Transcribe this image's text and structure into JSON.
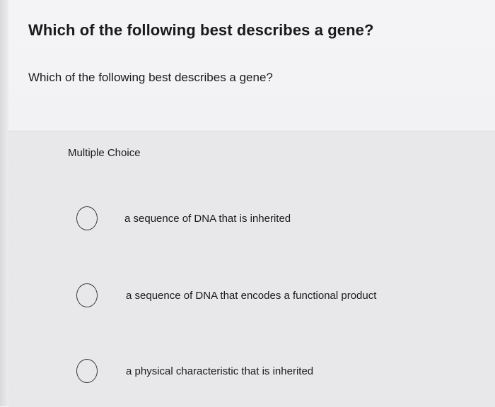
{
  "title": "Which of the following best describes a gene?",
  "question": "Which of the following best describes a gene?",
  "question_type": "Multiple Choice",
  "options": [
    {
      "label": "a sequence of DNA that is inherited",
      "selected": false
    },
    {
      "label": "a sequence of DNA that encodes a functional product",
      "selected": false
    },
    {
      "label": "a physical characteristic that is inherited",
      "selected": false
    }
  ]
}
